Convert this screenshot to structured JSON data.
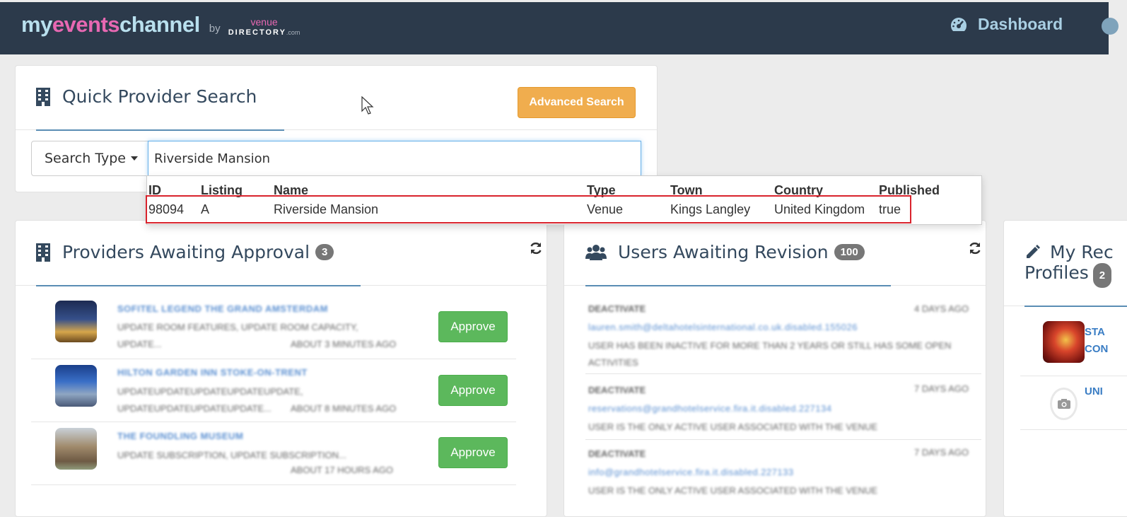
{
  "nav": {
    "logo_my": "my",
    "logo_events": "events",
    "logo_channel": "channel",
    "logo_by": "by",
    "logo_venue": "venue",
    "logo_directory": "DIRECTORY",
    "logo_com": ".com",
    "dashboard_label": "Dashboard"
  },
  "quick_search": {
    "title": "Quick Provider Search",
    "advanced_button": "Advanced Search",
    "search_type_label": "Search Type",
    "input_value": "Riverside Mansion"
  },
  "results": {
    "headers": [
      "ID",
      "Listing",
      "Name",
      "Type",
      "Town",
      "Country",
      "Published"
    ],
    "rows": [
      [
        "98094",
        "A",
        "Riverside Mansion",
        "Venue",
        "Kings Langley",
        "United Kingdom",
        "true"
      ]
    ]
  },
  "providers": {
    "title": "Providers Awaiting Approval",
    "count": "3",
    "items": [
      {
        "name": "SOFITEL LEGEND THE GRAND AMSTERDAM",
        "line1": "UPDATE ROOM FEATURES, UPDATE ROOM CAPACITY,",
        "line2": "UPDATE...",
        "time": "ABOUT 3 MINUTES AGO",
        "approve": "Approve"
      },
      {
        "name": "HILTON GARDEN INN STOKE-ON-TRENT",
        "line1": "UPDATEUPDATEUPDATEUPDATEUPDATE,",
        "line2": "UPDATEUPDATEUPDATEUPDATE...",
        "time": "ABOUT 8 MINUTES AGO",
        "approve": "Approve"
      },
      {
        "name": "THE FOUNDLING MUSEUM",
        "line1": "UPDATE SUBSCRIPTION, UPDATE SUBSCRIPTION...",
        "line2": "",
        "time": "ABOUT 17 HOURS AGO",
        "approve": "Approve"
      }
    ]
  },
  "users": {
    "title": "Users Awaiting Revision",
    "count": "100",
    "items": [
      {
        "action": "DEACTIVATE",
        "age": "4 DAYS AGO",
        "email": "lauren.smith@deltahotelsinternational.co.uk.disabled.155026",
        "note": "USER HAS BEEN INACTIVE FOR MORE THAN 2 YEARS OR STILL HAS SOME OPEN",
        "note2": "ACTIVITIES"
      },
      {
        "action": "DEACTIVATE",
        "age": "7 DAYS AGO",
        "email": "reservations@grandhotelservice.fira.it.disabled.227134",
        "note": "USER IS THE ONLY ACTIVE USER ASSOCIATED WITH THE VENUE",
        "note2": ""
      },
      {
        "action": "DEACTIVATE",
        "age": "7 DAYS AGO",
        "email": "info@grandhotelservice.fira.it.disabled.227133",
        "note": "USER IS THE ONLY ACTIVE USER ASSOCIATED WITH THE VENUE",
        "note2": ""
      }
    ]
  },
  "recent": {
    "title_line1": "My Rec",
    "title_line2": "Profiles",
    "items": [
      {
        "name_line1": "STA",
        "name_line2": "CON"
      },
      {
        "name_line1": "UNI",
        "name_line2": ""
      }
    ]
  },
  "icons": {
    "building": "building-icon",
    "users": "users-icon",
    "pencil": "pencil-icon",
    "refresh": "refresh-icon",
    "dashboard": "dashboard-gauge-icon"
  }
}
